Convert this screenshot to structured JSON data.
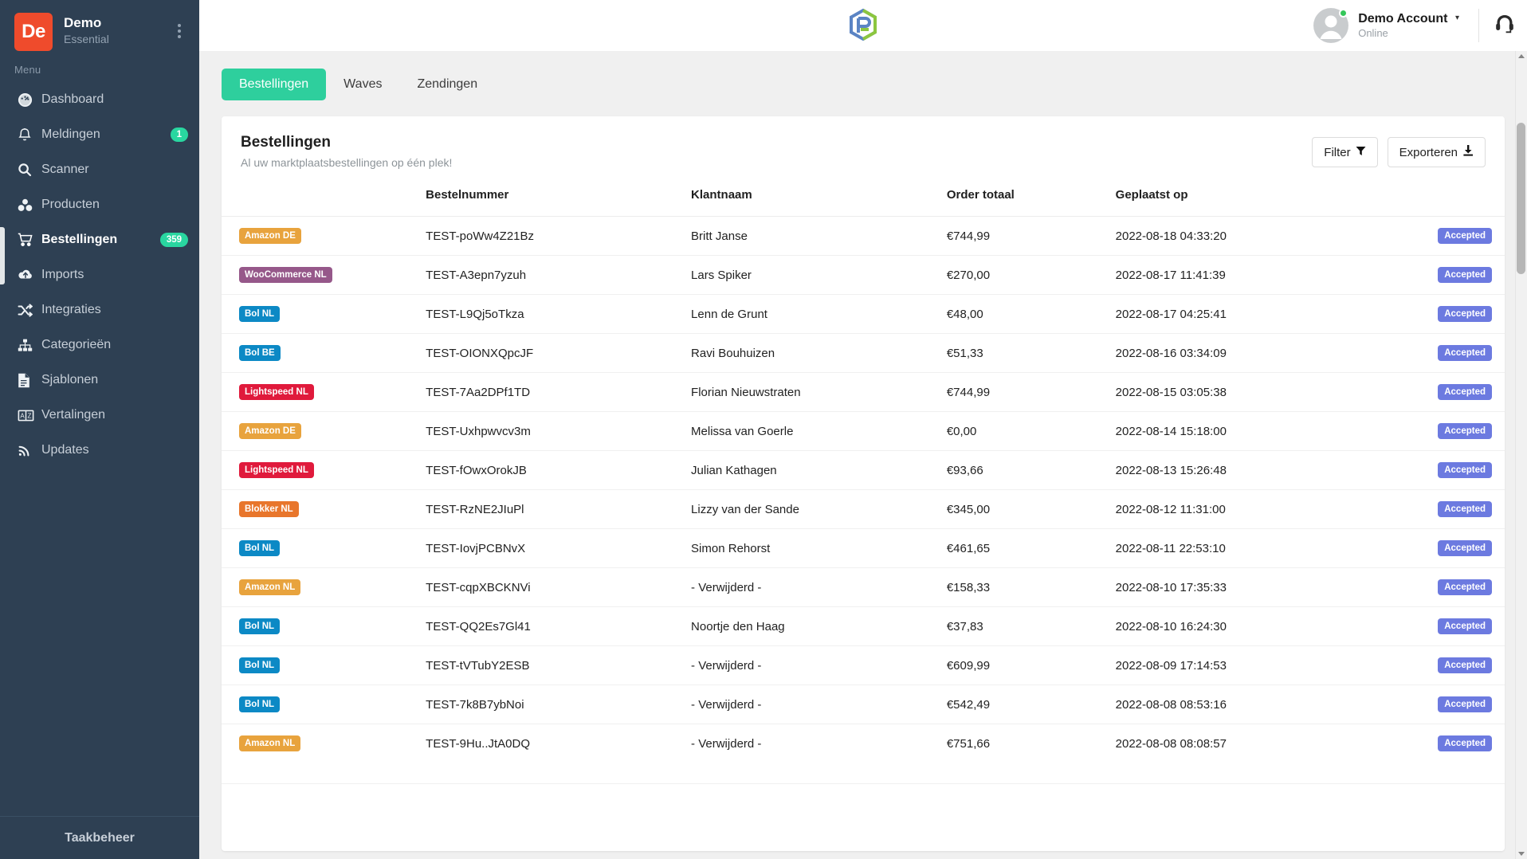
{
  "sidebar": {
    "brand": {
      "logo_text": "De",
      "title": "Demo",
      "subtitle": "Essential",
      "logo_color": "#ef4b2c"
    },
    "menu_label": "Menu",
    "items": [
      {
        "label": "Dashboard",
        "icon": "dashboard-icon",
        "badge": ""
      },
      {
        "label": "Meldingen",
        "icon": "bell-icon",
        "badge": "1"
      },
      {
        "label": "Scanner",
        "icon": "search-icon",
        "badge": ""
      },
      {
        "label": "Producten",
        "icon": "boxes-icon",
        "badge": ""
      },
      {
        "label": "Bestellingen",
        "icon": "shopping-cart-icon",
        "badge": "359",
        "active": true
      },
      {
        "label": "Imports",
        "icon": "cloud-upload-icon",
        "badge": ""
      },
      {
        "label": "Integraties",
        "icon": "shuffle-icon",
        "badge": ""
      },
      {
        "label": "Categorieën",
        "icon": "sitemap-icon",
        "badge": ""
      },
      {
        "label": "Sjablonen",
        "icon": "document-icon",
        "badge": ""
      },
      {
        "label": "Vertalingen",
        "icon": "translate-icon",
        "badge": ""
      },
      {
        "label": "Updates",
        "icon": "rss-icon",
        "badge": ""
      }
    ],
    "footer_label": "Taakbeheer",
    "badge_color": "#29d6a0",
    "background": "#2e4053"
  },
  "topbar": {
    "logo": "platform-hexagon-logo",
    "account_name": "Demo Account",
    "account_status": "Online",
    "caret": "▾",
    "support_icon": "headset-icon",
    "online_color": "#35c75a"
  },
  "tabs": [
    {
      "label": "Bestellingen",
      "active": true
    },
    {
      "label": "Waves",
      "active": false
    },
    {
      "label": "Zendingen",
      "active": false
    }
  ],
  "tab_active_color": "#2ecf9d",
  "card": {
    "title": "Bestellingen",
    "subtitle": "Al uw marktplaatsbestellingen op één plek!",
    "filter_label": "Filter",
    "filter_icon": "funnel-icon",
    "export_label": "Exporteren",
    "export_icon": "download-icon"
  },
  "table": {
    "columns": [
      "",
      "Bestelnummer",
      "Klantnaam",
      "Order totaal",
      "Geplaatst op",
      ""
    ],
    "status_color": "#6c7ae0",
    "marketplace_colors": {
      "Amazon DE": "#e8a33d",
      "Amazon NL": "#e8a33d",
      "WooCommerce NL": "#96588a",
      "Bol NL": "#0c89c5",
      "Bol BE": "#0c89c5",
      "Lightspeed NL": "#e01a3c",
      "Blokker NL": "#e8762c"
    },
    "rows": [
      {
        "marketplace": "Amazon DE",
        "order_number": "TEST-poWw4Z21Bz",
        "customer": "Britt Janse",
        "total": "€744,99",
        "placed_at": "2022-08-18 04:33:20",
        "status": "Accepted"
      },
      {
        "marketplace": "WooCommerce NL",
        "order_number": "TEST-A3epn7yzuh",
        "customer": "Lars Spiker",
        "total": "€270,00",
        "placed_at": "2022-08-17 11:41:39",
        "status": "Accepted"
      },
      {
        "marketplace": "Bol NL",
        "order_number": "TEST-L9Qj5oTkza",
        "customer": "Lenn de Grunt",
        "total": "€48,00",
        "placed_at": "2022-08-17 04:25:41",
        "status": "Accepted"
      },
      {
        "marketplace": "Bol BE",
        "order_number": "TEST-OIONXQpcJF",
        "customer": "Ravi Bouhuizen",
        "total": "€51,33",
        "placed_at": "2022-08-16 03:34:09",
        "status": "Accepted"
      },
      {
        "marketplace": "Lightspeed NL",
        "order_number": "TEST-7Aa2DPf1TD",
        "customer": "Florian Nieuwstraten",
        "total": "€744,99",
        "placed_at": "2022-08-15 03:05:38",
        "status": "Accepted"
      },
      {
        "marketplace": "Amazon DE",
        "order_number": "TEST-Uxhpwvcv3m",
        "customer": "Melissa van Goerle",
        "total": "€0,00",
        "placed_at": "2022-08-14 15:18:00",
        "status": "Accepted"
      },
      {
        "marketplace": "Lightspeed NL",
        "order_number": "TEST-fOwxOrokJB",
        "customer": "Julian Kathagen",
        "total": "€93,66",
        "placed_at": "2022-08-13 15:26:48",
        "status": "Accepted"
      },
      {
        "marketplace": "Blokker NL",
        "order_number": "TEST-RzNE2JIuPl",
        "customer": "Lizzy van der Sande",
        "total": "€345,00",
        "placed_at": "2022-08-12 11:31:00",
        "status": "Accepted"
      },
      {
        "marketplace": "Bol NL",
        "order_number": "TEST-IovjPCBNvX",
        "customer": "Simon Rehorst",
        "total": "€461,65",
        "placed_at": "2022-08-11 22:53:10",
        "status": "Accepted"
      },
      {
        "marketplace": "Amazon NL",
        "order_number": "TEST-cqpXBCKNVi",
        "customer": "- Verwijderd -",
        "total": "€158,33",
        "placed_at": "2022-08-10 17:35:33",
        "status": "Accepted"
      },
      {
        "marketplace": "Bol NL",
        "order_number": "TEST-QQ2Es7Gl41",
        "customer": "Noortje den Haag",
        "total": "€37,83",
        "placed_at": "2022-08-10 16:24:30",
        "status": "Accepted"
      },
      {
        "marketplace": "Bol NL",
        "order_number": "TEST-tVTubY2ESB",
        "customer": "- Verwijderd -",
        "total": "€609,99",
        "placed_at": "2022-08-09 17:14:53",
        "status": "Accepted"
      },
      {
        "marketplace": "Bol NL",
        "order_number": "TEST-7k8B7ybNoi",
        "customer": "- Verwijderd -",
        "total": "€542,49",
        "placed_at": "2022-08-08 08:53:16",
        "status": "Accepted"
      },
      {
        "marketplace": "Amazon NL",
        "order_number": "TEST-9Hu..JtA0DQ",
        "customer": "- Verwijderd -",
        "total": "€751,66",
        "placed_at": "2022-08-08 08:08:57",
        "status": "Accepted"
      }
    ]
  }
}
